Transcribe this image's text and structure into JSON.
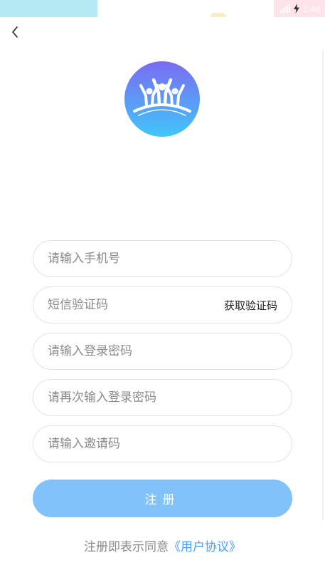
{
  "status_bar": {
    "time": "1:46"
  },
  "nav": {
    "back_icon": "chevron-left-icon"
  },
  "logo": {
    "icon": "people-cheering-logo",
    "gradient_top": "#7b6cf0",
    "gradient_bottom": "#3fc7fb"
  },
  "form": {
    "phone": {
      "value": "",
      "placeholder": "请输入手机号"
    },
    "sms_code": {
      "value": "",
      "placeholder": "短信验证码",
      "get_code_label": "获取验证码"
    },
    "password": {
      "value": "",
      "placeholder": "请输入登录密码"
    },
    "confirm_password": {
      "value": "",
      "placeholder": "请再次输入登录密码"
    },
    "invite_code": {
      "value": "",
      "placeholder": "请输入邀请码"
    }
  },
  "register": {
    "label": "注册",
    "color": "#82c2fb"
  },
  "agreement": {
    "prefix": "注册即表示同意",
    "link": "《用户协议》",
    "link_color": "#4a9df8"
  }
}
